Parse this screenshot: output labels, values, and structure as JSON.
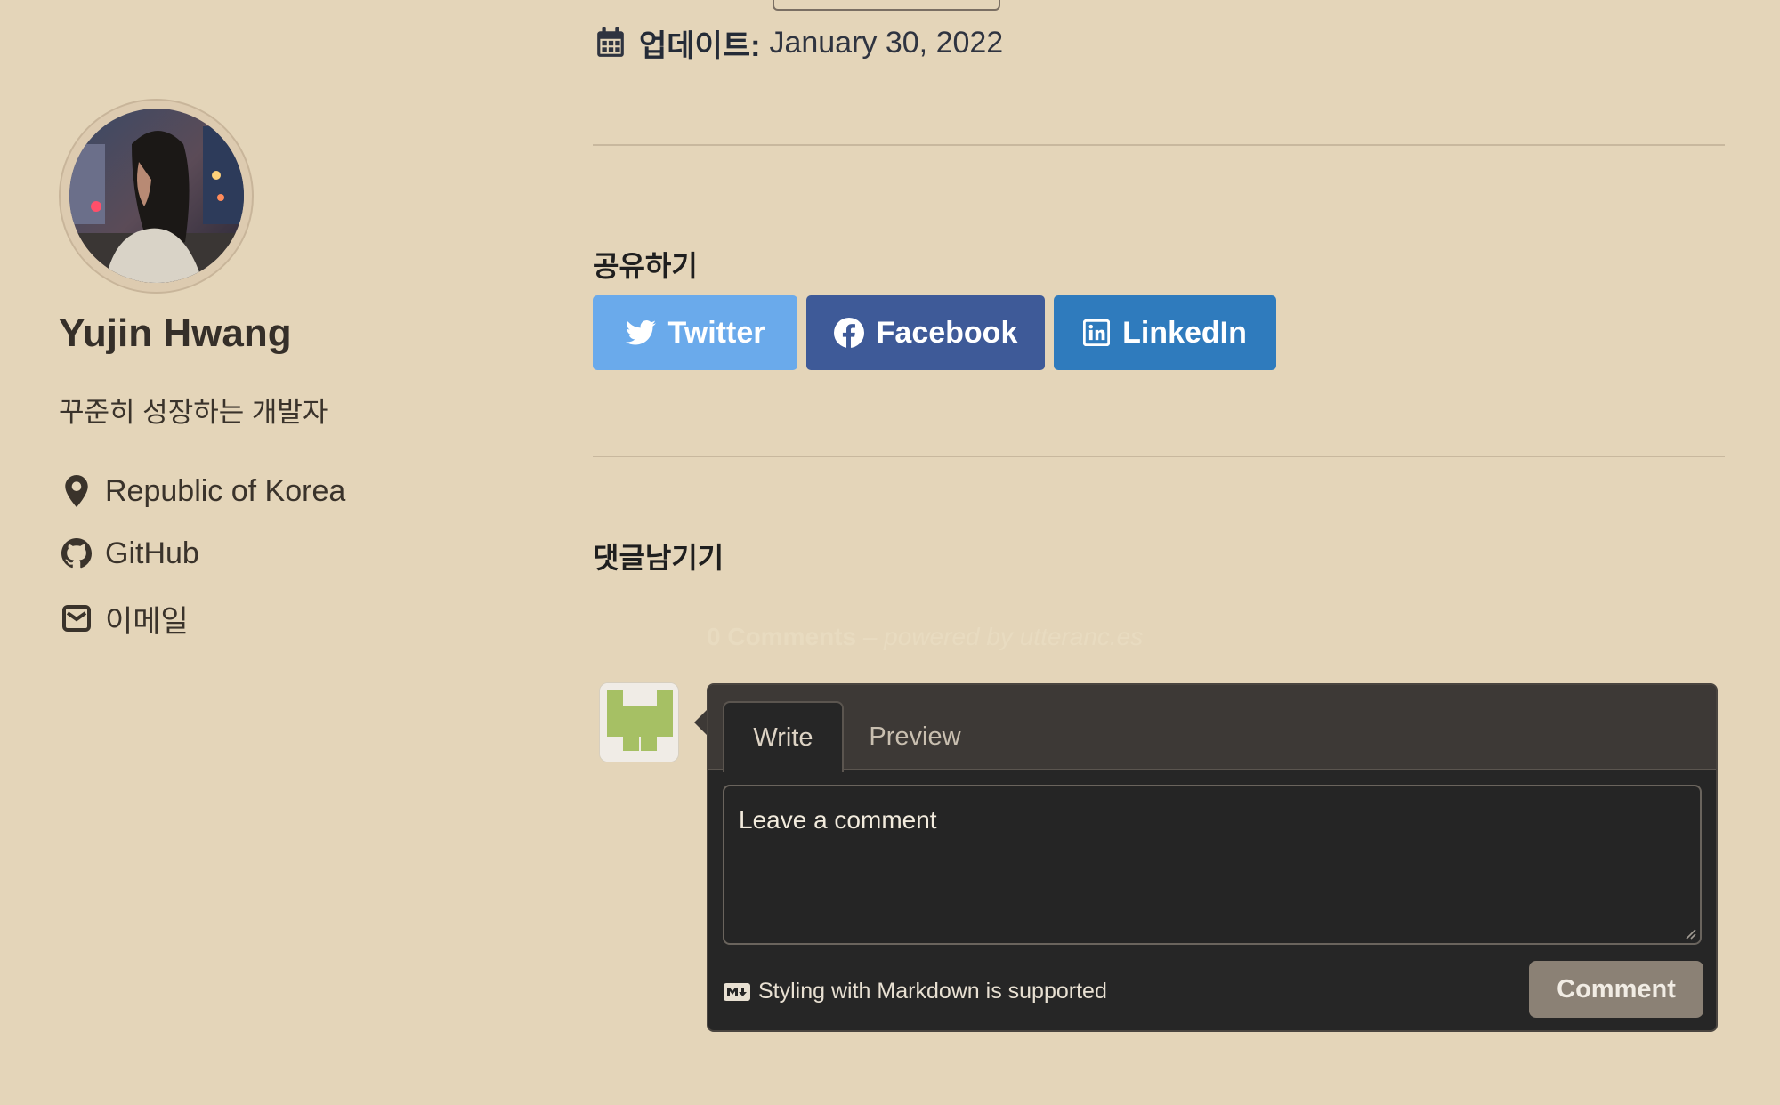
{
  "sidebar": {
    "author_name": "Yujin Hwang",
    "bio": "꾸준히 성장하는 개발자",
    "location": "Republic of Korea",
    "github_label": "GitHub",
    "email_label": "이메일",
    "icons": [
      "location-pin-icon",
      "github-icon",
      "mail-icon"
    ]
  },
  "post": {
    "updated_label": "업데이트:",
    "updated_date": "January 30, 2022"
  },
  "share": {
    "title": "공유하기",
    "twitter": "Twitter",
    "facebook": "Facebook",
    "linkedin": "LinkedIn",
    "colors": {
      "twitter": "#6aaaeb",
      "facebook": "#3e5a98",
      "linkedin": "#2f7bbd"
    }
  },
  "comments": {
    "title": "댓글남기기",
    "count_text": "0 Comments",
    "powered_by": " – powered by utteranc.es",
    "tab_write": "Write",
    "tab_preview": "Preview",
    "input_placeholder": "Leave a comment",
    "markdown_note": "Styling with Markdown is supported",
    "submit_label": "Comment"
  },
  "theme": {
    "page_background": "#e4d5b9",
    "comment_box_background": "#262626"
  }
}
